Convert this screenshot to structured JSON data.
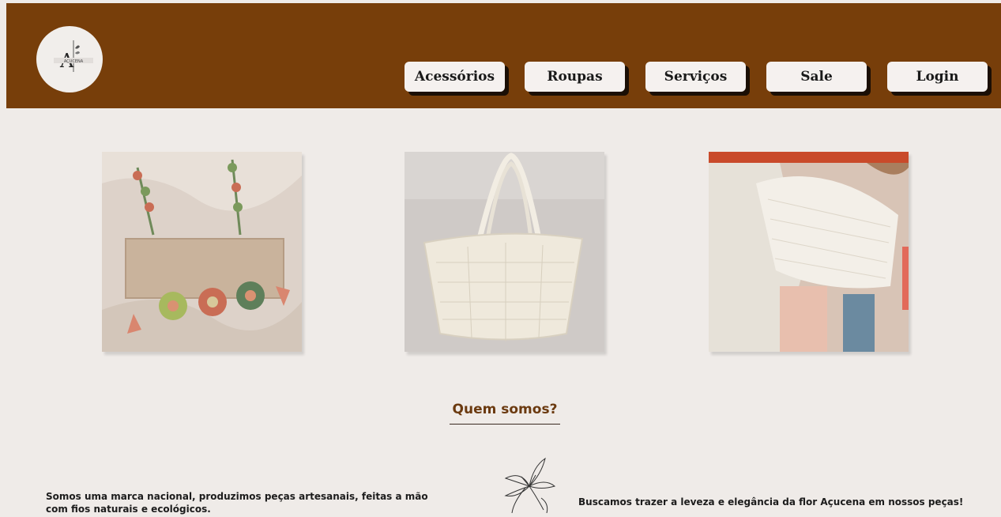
{
  "header": {
    "logo": {
      "icon": "acucena-logo-icon",
      "monogram": "A",
      "brand": "AÇUCENA"
    },
    "nav": [
      {
        "label": "Acessórios"
      },
      {
        "label": "Roupas"
      },
      {
        "label": "Serviços"
      },
      {
        "label": "Sale"
      },
      {
        "label": "Login"
      }
    ]
  },
  "products": [
    {
      "icon": "crochet-flower-top-image"
    },
    {
      "icon": "crochet-tote-bag-image"
    },
    {
      "icon": "crochet-halter-top-image"
    }
  ],
  "about": {
    "title": "Quem somos?",
    "text_left": "Somos uma marca nacional, produzimos peças artesanais, feitas a mão com fios naturais e ecológicos.",
    "text_right": "Buscamos trazer a leveza e elegância da flor Açucena em nossos peças!",
    "flower_icon": "lily-flower-icon"
  },
  "colors": {
    "header_bg": "#773e0a",
    "page_bg": "#efebe8",
    "button_bg": "#f5f1ef",
    "title_color": "#6b3a10"
  }
}
